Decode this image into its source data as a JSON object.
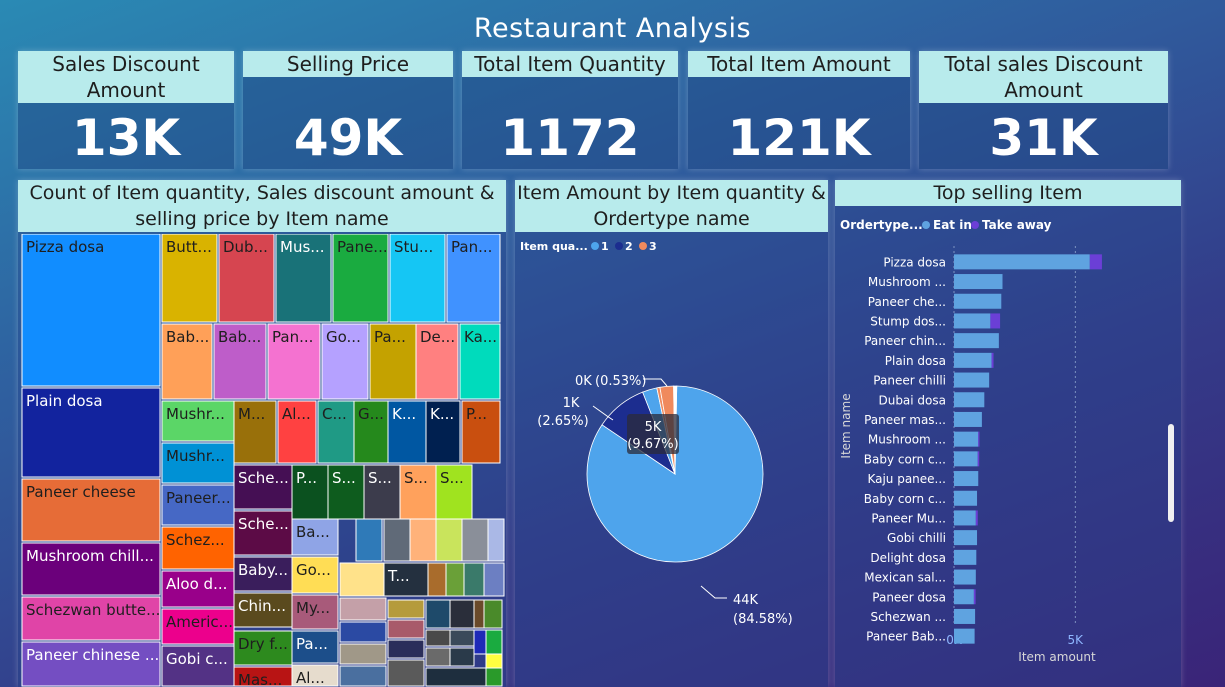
{
  "title": "Restaurant Analysis",
  "kpis": [
    {
      "label": "Sales Discount Amount",
      "value": "13K"
    },
    {
      "label": "Selling Price",
      "value": "49K"
    },
    {
      "label": "Total Item Quantity",
      "value": "1172"
    },
    {
      "label": "Total Item Amount",
      "value": "121K"
    },
    {
      "label": "Total sales Discount Amount",
      "value": "31K"
    }
  ],
  "panels": {
    "treemap_title": "Count of Item quantity, Sales discount amount & selling price by Item name",
    "pie_title": "Item Amount by Item quantity & Ordertype name",
    "bar_title": "Top selling Item"
  },
  "chart_data": [
    {
      "type": "treemap",
      "title": "Count of Item quantity, Sales discount amount & selling price by Item name",
      "labels": [
        "Pizza dosa",
        "Plain dosa",
        "Paneer cheese",
        "Mushroom chill...",
        "Schezwan butte...",
        "Paneer chinese ...",
        "Butt...",
        "Dub...",
        "Mus...",
        "Pane...",
        "Stu...",
        "Pan...",
        "Bab...",
        "Bab...",
        "Pan...",
        "Go...",
        "Pa...",
        "De...",
        "Ka...",
        "Mushr...",
        "Mushr...",
        "Paneer...",
        "Schez...",
        "Aloo d...",
        "Americ...",
        "Gobi c...",
        "M...",
        "Al...",
        "C...",
        "G...",
        "K...",
        "K...",
        "P...",
        "Sche...",
        "P...",
        "S...",
        "S...",
        "S...",
        "S...",
        "Sche...",
        "Ba...",
        "Baby...",
        "Go...",
        "Chin...",
        "My...",
        "Dry f...",
        "Pa...",
        "Mas...",
        "Al...",
        "T..."
      ],
      "colors": [
        "#118dff",
        "#12239e",
        "#e66c37",
        "#6b007b",
        "#e044a7",
        "#744ec2",
        "#d9b300",
        "#d64550",
        "#197278",
        "#1aab40",
        "#15c6f4",
        "#4092ff",
        "#ffa058",
        "#be5dc9",
        "#f472d0",
        "#b5a1ff",
        "#c4a200",
        "#ff8080",
        "#00dbbc",
        "#5bd667",
        "#0091d5",
        "#4668c5",
        "#ff6300",
        "#99008a",
        "#ec008c",
        "#533285",
        "#99700a",
        "#ff4141",
        "#1f9a85",
        "#25891c",
        "#0057a2",
        "#002050",
        "#c94f0f",
        "#450f54",
        "#0b511f",
        "#0e5c1e",
        "#3c3c4c",
        "#ffa15c",
        "#a0e31f",
        "#5c0b46",
        "#8fa4e6",
        "#3a1e5c",
        "#ffdd55",
        "#5a4a1e",
        "#a85a7a",
        "#2d8a1e",
        "#1c4e8a",
        "#b81414",
        "#e6dccd",
        "#24303f"
      ],
      "x": "Item name"
    },
    {
      "type": "pie",
      "title": "Item Amount by Item quantity & Ordertype name",
      "legend_title": "Item qua...",
      "legend_position": "top-left",
      "categories": [
        "1",
        "2",
        "3"
      ],
      "colors": [
        "#4ea4ec",
        "#1c2d8f",
        "#f08a5d"
      ],
      "slices": [
        {
          "label": "44K",
          "pct": "(84.58%)",
          "value": 44000,
          "color": "#4ea4ec"
        },
        {
          "label": "5K",
          "pct": "(9.67%)",
          "value": 5000,
          "color": "#1c2d8f"
        },
        {
          "label": "1K",
          "pct": "(2.65%)",
          "value": 1400,
          "color": "#4ea4ec"
        },
        {
          "label": "0K",
          "pct": "(0.53%)",
          "value": 300,
          "color": "#f08a5d"
        },
        {
          "label": "",
          "pct": "",
          "value": 1300,
          "color": "#f08a5d"
        },
        {
          "label": "",
          "pct": "",
          "value": 300,
          "color": "#ffffff"
        }
      ]
    },
    {
      "type": "bar",
      "orientation": "horizontal",
      "stacked": true,
      "title": "Top selling Item",
      "legend_title": "Ordertype...",
      "legend_position": "top-left",
      "xlabel": "Item amount",
      "ylabel": "Item name",
      "xlim": [
        0,
        8000
      ],
      "xticks": [
        "0K",
        "5K"
      ],
      "xtick_values": [
        0,
        5000
      ],
      "grid": true,
      "categories": [
        "Pizza dosa",
        "Mushroom ...",
        "Paneer che...",
        "Stump dos...",
        "Paneer chin...",
        "Plain dosa",
        "Paneer chilli",
        "Dubai dosa",
        "Paneer mas...",
        "Mushroom ...",
        "Baby corn c...",
        "Kaju panee...",
        "Baby corn c...",
        "Paneer Mu...",
        "Gobi chilli",
        "Delight dosa",
        "Mexican sal...",
        "Paneer dosa",
        "Schezwan ...",
        "Paneer Bab..."
      ],
      "series": [
        {
          "name": "Eat in",
          "color": "#5fa3e0",
          "values": [
            5600,
            2000,
            1950,
            1500,
            1850,
            1550,
            1450,
            1250,
            1150,
            1000,
            980,
            1000,
            950,
            900,
            950,
            920,
            900,
            820,
            870,
            850
          ]
        },
        {
          "name": "Take away",
          "color": "#6b3fd6",
          "values": [
            500,
            0,
            0,
            400,
            0,
            80,
            0,
            0,
            0,
            50,
            60,
            0,
            0,
            80,
            0,
            0,
            0,
            70,
            0,
            0
          ]
        }
      ]
    }
  ]
}
